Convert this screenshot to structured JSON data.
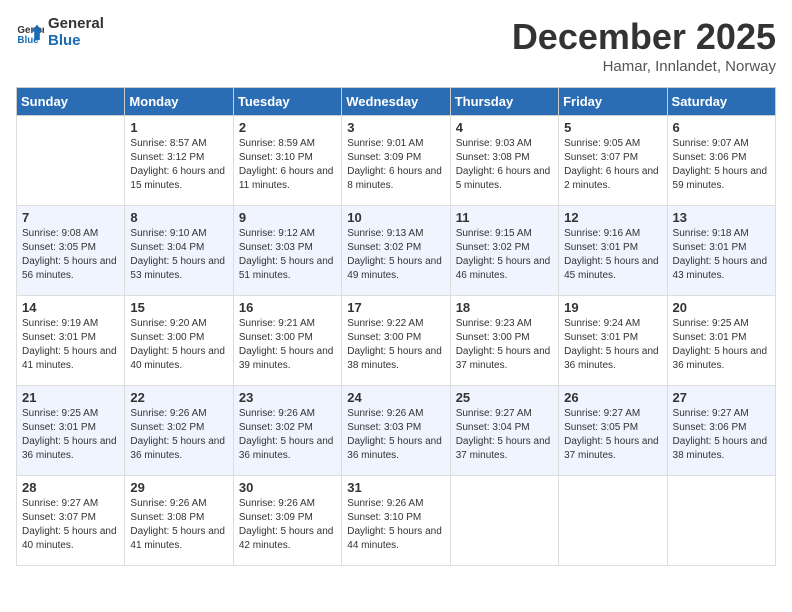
{
  "logo": {
    "line1": "General",
    "line2": "Blue"
  },
  "title": "December 2025",
  "location": "Hamar, Innlandet, Norway",
  "days_of_week": [
    "Sunday",
    "Monday",
    "Tuesday",
    "Wednesday",
    "Thursday",
    "Friday",
    "Saturday"
  ],
  "weeks": [
    [
      {
        "day": "",
        "empty": true
      },
      {
        "day": "1",
        "sunrise": "8:57 AM",
        "sunset": "3:12 PM",
        "daylight": "6 hours and 15 minutes."
      },
      {
        "day": "2",
        "sunrise": "8:59 AM",
        "sunset": "3:10 PM",
        "daylight": "6 hours and 11 minutes."
      },
      {
        "day": "3",
        "sunrise": "9:01 AM",
        "sunset": "3:09 PM",
        "daylight": "6 hours and 8 minutes."
      },
      {
        "day": "4",
        "sunrise": "9:03 AM",
        "sunset": "3:08 PM",
        "daylight": "6 hours and 5 minutes."
      },
      {
        "day": "5",
        "sunrise": "9:05 AM",
        "sunset": "3:07 PM",
        "daylight": "6 hours and 2 minutes."
      },
      {
        "day": "6",
        "sunrise": "9:07 AM",
        "sunset": "3:06 PM",
        "daylight": "5 hours and 59 minutes."
      }
    ],
    [
      {
        "day": "7",
        "sunrise": "9:08 AM",
        "sunset": "3:05 PM",
        "daylight": "5 hours and 56 minutes."
      },
      {
        "day": "8",
        "sunrise": "9:10 AM",
        "sunset": "3:04 PM",
        "daylight": "5 hours and 53 minutes."
      },
      {
        "day": "9",
        "sunrise": "9:12 AM",
        "sunset": "3:03 PM",
        "daylight": "5 hours and 51 minutes."
      },
      {
        "day": "10",
        "sunrise": "9:13 AM",
        "sunset": "3:02 PM",
        "daylight": "5 hours and 49 minutes."
      },
      {
        "day": "11",
        "sunrise": "9:15 AM",
        "sunset": "3:02 PM",
        "daylight": "5 hours and 46 minutes."
      },
      {
        "day": "12",
        "sunrise": "9:16 AM",
        "sunset": "3:01 PM",
        "daylight": "5 hours and 45 minutes."
      },
      {
        "day": "13",
        "sunrise": "9:18 AM",
        "sunset": "3:01 PM",
        "daylight": "5 hours and 43 minutes."
      }
    ],
    [
      {
        "day": "14",
        "sunrise": "9:19 AM",
        "sunset": "3:01 PM",
        "daylight": "5 hours and 41 minutes."
      },
      {
        "day": "15",
        "sunrise": "9:20 AM",
        "sunset": "3:00 PM",
        "daylight": "5 hours and 40 minutes."
      },
      {
        "day": "16",
        "sunrise": "9:21 AM",
        "sunset": "3:00 PM",
        "daylight": "5 hours and 39 minutes."
      },
      {
        "day": "17",
        "sunrise": "9:22 AM",
        "sunset": "3:00 PM",
        "daylight": "5 hours and 38 minutes."
      },
      {
        "day": "18",
        "sunrise": "9:23 AM",
        "sunset": "3:00 PM",
        "daylight": "5 hours and 37 minutes."
      },
      {
        "day": "19",
        "sunrise": "9:24 AM",
        "sunset": "3:01 PM",
        "daylight": "5 hours and 36 minutes."
      },
      {
        "day": "20",
        "sunrise": "9:25 AM",
        "sunset": "3:01 PM",
        "daylight": "5 hours and 36 minutes."
      }
    ],
    [
      {
        "day": "21",
        "sunrise": "9:25 AM",
        "sunset": "3:01 PM",
        "daylight": "5 hours and 36 minutes."
      },
      {
        "day": "22",
        "sunrise": "9:26 AM",
        "sunset": "3:02 PM",
        "daylight": "5 hours and 36 minutes."
      },
      {
        "day": "23",
        "sunrise": "9:26 AM",
        "sunset": "3:02 PM",
        "daylight": "5 hours and 36 minutes."
      },
      {
        "day": "24",
        "sunrise": "9:26 AM",
        "sunset": "3:03 PM",
        "daylight": "5 hours and 36 minutes."
      },
      {
        "day": "25",
        "sunrise": "9:27 AM",
        "sunset": "3:04 PM",
        "daylight": "5 hours and 37 minutes."
      },
      {
        "day": "26",
        "sunrise": "9:27 AM",
        "sunset": "3:05 PM",
        "daylight": "5 hours and 37 minutes."
      },
      {
        "day": "27",
        "sunrise": "9:27 AM",
        "sunset": "3:06 PM",
        "daylight": "5 hours and 38 minutes."
      }
    ],
    [
      {
        "day": "28",
        "sunrise": "9:27 AM",
        "sunset": "3:07 PM",
        "daylight": "5 hours and 40 minutes."
      },
      {
        "day": "29",
        "sunrise": "9:26 AM",
        "sunset": "3:08 PM",
        "daylight": "5 hours and 41 minutes."
      },
      {
        "day": "30",
        "sunrise": "9:26 AM",
        "sunset": "3:09 PM",
        "daylight": "5 hours and 42 minutes."
      },
      {
        "day": "31",
        "sunrise": "9:26 AM",
        "sunset": "3:10 PM",
        "daylight": "5 hours and 44 minutes."
      },
      {
        "day": "",
        "empty": true
      },
      {
        "day": "",
        "empty": true
      },
      {
        "day": "",
        "empty": true
      }
    ]
  ],
  "labels": {
    "sunrise_prefix": "Sunrise: ",
    "sunset_prefix": "Sunset: ",
    "daylight_prefix": "Daylight: "
  }
}
